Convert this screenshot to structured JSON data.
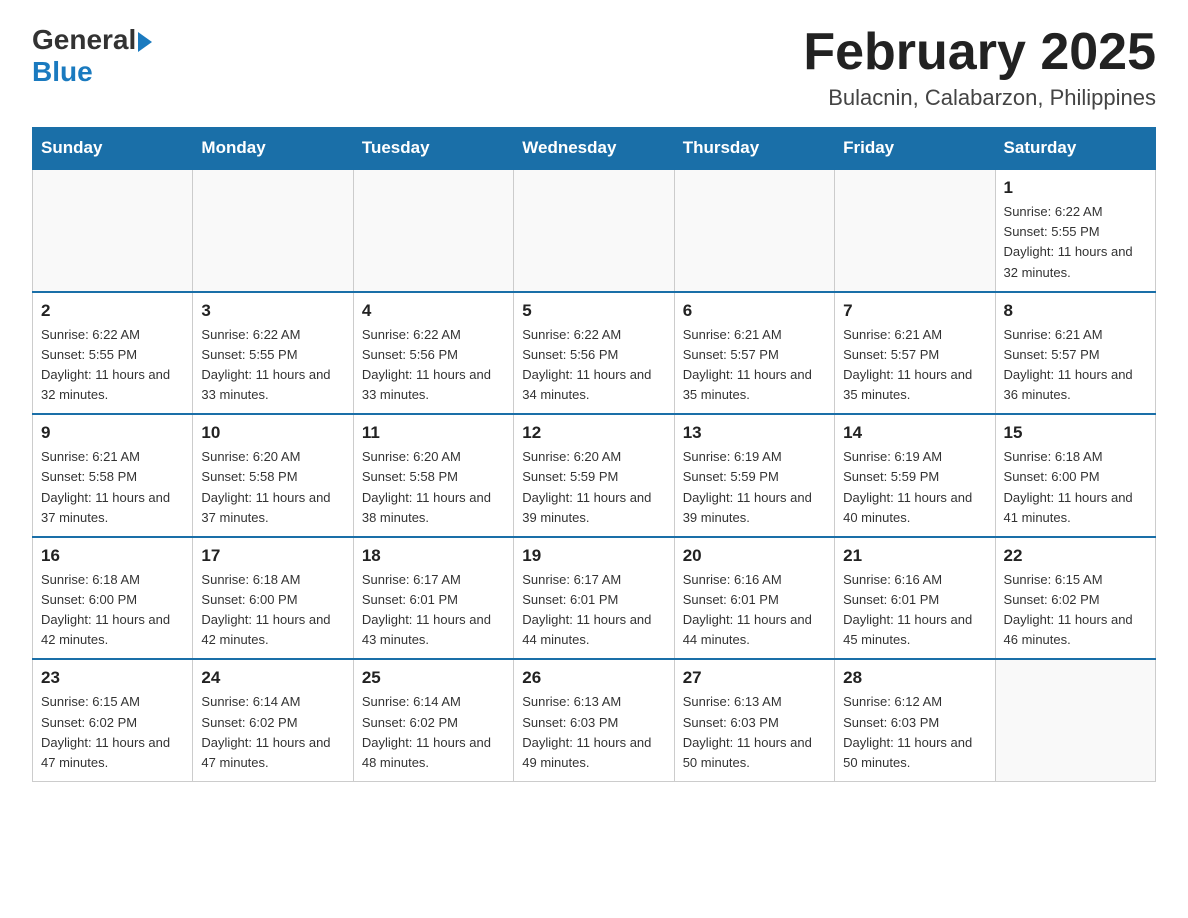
{
  "header": {
    "logo": {
      "general": "General",
      "blue": "Blue"
    },
    "month_title": "February 2025",
    "location": "Bulacnin, Calabarzon, Philippines"
  },
  "weekdays": [
    "Sunday",
    "Monday",
    "Tuesday",
    "Wednesday",
    "Thursday",
    "Friday",
    "Saturday"
  ],
  "weeks": [
    [
      {
        "day": "",
        "info": ""
      },
      {
        "day": "",
        "info": ""
      },
      {
        "day": "",
        "info": ""
      },
      {
        "day": "",
        "info": ""
      },
      {
        "day": "",
        "info": ""
      },
      {
        "day": "",
        "info": ""
      },
      {
        "day": "1",
        "info": "Sunrise: 6:22 AM\nSunset: 5:55 PM\nDaylight: 11 hours\nand 32 minutes."
      }
    ],
    [
      {
        "day": "2",
        "info": "Sunrise: 6:22 AM\nSunset: 5:55 PM\nDaylight: 11 hours\nand 32 minutes."
      },
      {
        "day": "3",
        "info": "Sunrise: 6:22 AM\nSunset: 5:55 PM\nDaylight: 11 hours\nand 33 minutes."
      },
      {
        "day": "4",
        "info": "Sunrise: 6:22 AM\nSunset: 5:56 PM\nDaylight: 11 hours\nand 33 minutes."
      },
      {
        "day": "5",
        "info": "Sunrise: 6:22 AM\nSunset: 5:56 PM\nDaylight: 11 hours\nand 34 minutes."
      },
      {
        "day": "6",
        "info": "Sunrise: 6:21 AM\nSunset: 5:57 PM\nDaylight: 11 hours\nand 35 minutes."
      },
      {
        "day": "7",
        "info": "Sunrise: 6:21 AM\nSunset: 5:57 PM\nDaylight: 11 hours\nand 35 minutes."
      },
      {
        "day": "8",
        "info": "Sunrise: 6:21 AM\nSunset: 5:57 PM\nDaylight: 11 hours\nand 36 minutes."
      }
    ],
    [
      {
        "day": "9",
        "info": "Sunrise: 6:21 AM\nSunset: 5:58 PM\nDaylight: 11 hours\nand 37 minutes."
      },
      {
        "day": "10",
        "info": "Sunrise: 6:20 AM\nSunset: 5:58 PM\nDaylight: 11 hours\nand 37 minutes."
      },
      {
        "day": "11",
        "info": "Sunrise: 6:20 AM\nSunset: 5:58 PM\nDaylight: 11 hours\nand 38 minutes."
      },
      {
        "day": "12",
        "info": "Sunrise: 6:20 AM\nSunset: 5:59 PM\nDaylight: 11 hours\nand 39 minutes."
      },
      {
        "day": "13",
        "info": "Sunrise: 6:19 AM\nSunset: 5:59 PM\nDaylight: 11 hours\nand 39 minutes."
      },
      {
        "day": "14",
        "info": "Sunrise: 6:19 AM\nSunset: 5:59 PM\nDaylight: 11 hours\nand 40 minutes."
      },
      {
        "day": "15",
        "info": "Sunrise: 6:18 AM\nSunset: 6:00 PM\nDaylight: 11 hours\nand 41 minutes."
      }
    ],
    [
      {
        "day": "16",
        "info": "Sunrise: 6:18 AM\nSunset: 6:00 PM\nDaylight: 11 hours\nand 42 minutes."
      },
      {
        "day": "17",
        "info": "Sunrise: 6:18 AM\nSunset: 6:00 PM\nDaylight: 11 hours\nand 42 minutes."
      },
      {
        "day": "18",
        "info": "Sunrise: 6:17 AM\nSunset: 6:01 PM\nDaylight: 11 hours\nand 43 minutes."
      },
      {
        "day": "19",
        "info": "Sunrise: 6:17 AM\nSunset: 6:01 PM\nDaylight: 11 hours\nand 44 minutes."
      },
      {
        "day": "20",
        "info": "Sunrise: 6:16 AM\nSunset: 6:01 PM\nDaylight: 11 hours\nand 44 minutes."
      },
      {
        "day": "21",
        "info": "Sunrise: 6:16 AM\nSunset: 6:01 PM\nDaylight: 11 hours\nand 45 minutes."
      },
      {
        "day": "22",
        "info": "Sunrise: 6:15 AM\nSunset: 6:02 PM\nDaylight: 11 hours\nand 46 minutes."
      }
    ],
    [
      {
        "day": "23",
        "info": "Sunrise: 6:15 AM\nSunset: 6:02 PM\nDaylight: 11 hours\nand 47 minutes."
      },
      {
        "day": "24",
        "info": "Sunrise: 6:14 AM\nSunset: 6:02 PM\nDaylight: 11 hours\nand 47 minutes."
      },
      {
        "day": "25",
        "info": "Sunrise: 6:14 AM\nSunset: 6:02 PM\nDaylight: 11 hours\nand 48 minutes."
      },
      {
        "day": "26",
        "info": "Sunrise: 6:13 AM\nSunset: 6:03 PM\nDaylight: 11 hours\nand 49 minutes."
      },
      {
        "day": "27",
        "info": "Sunrise: 6:13 AM\nSunset: 6:03 PM\nDaylight: 11 hours\nand 50 minutes."
      },
      {
        "day": "28",
        "info": "Sunrise: 6:12 AM\nSunset: 6:03 PM\nDaylight: 11 hours\nand 50 minutes."
      },
      {
        "day": "",
        "info": ""
      }
    ]
  ]
}
